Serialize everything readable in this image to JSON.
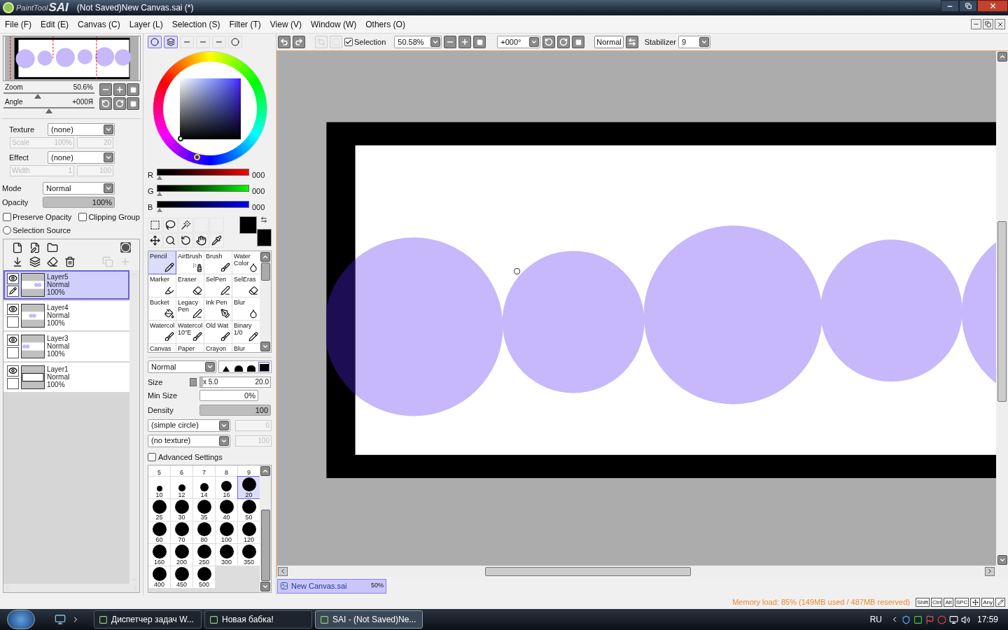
{
  "window": {
    "logo": [
      "PaintTool",
      "SAI"
    ],
    "title": "(Not Saved)New Canvas.sai (*)"
  },
  "menu": [
    "File (F)",
    "Edit (E)",
    "Canvas (C)",
    "Layer (L)",
    "Selection (S)",
    "Filter (T)",
    "View (V)",
    "Window (W)",
    "Others (O)"
  ],
  "navigator": {
    "sliders": [
      {
        "label": "Zoom",
        "value": "50.6%",
        "level": 0.38
      },
      {
        "label": "Angle",
        "value": "+000Я",
        "level": 0.5
      }
    ]
  },
  "texture": {
    "label": "Texture",
    "value": "(none)",
    "sub_label": "Scale",
    "sub_value": "100%",
    "amount": "20",
    "disabled": true
  },
  "effect": {
    "label": "Effect",
    "value": "(none)",
    "sub_label": "Width",
    "sub_value": "1",
    "amount": "100",
    "disabled": true
  },
  "mode": {
    "label": "Mode",
    "value": "Normal"
  },
  "opacity": {
    "label": "Opacity",
    "value": "100%",
    "level": 1
  },
  "options": [
    {
      "kind": "checkbox",
      "label": "Preserve Opacity",
      "checked": false
    },
    {
      "kind": "checkbox",
      "label": "Clipping Group",
      "checked": false
    },
    {
      "kind": "radio",
      "label": "Selection Source",
      "checked": false
    }
  ],
  "layers": [
    {
      "name": "Layer5",
      "mode": "Normal",
      "opacity": "100%",
      "selected": true,
      "visible": true
    },
    {
      "name": "Layer4",
      "mode": "Normal",
      "opacity": "100%",
      "selected": false,
      "visible": true
    },
    {
      "name": "Layer3",
      "mode": "Normal",
      "opacity": "100%",
      "selected": false,
      "visible": true
    },
    {
      "name": "Layer1",
      "mode": "Normal",
      "opacity": "100%",
      "selected": false,
      "visible": true
    }
  ],
  "color_tabs": [
    {
      "selected": true
    },
    {
      "selected": true
    },
    {
      "selected": false
    },
    {
      "selected": false
    },
    {
      "selected": false
    },
    {
      "selected": false
    }
  ],
  "rgb": [
    {
      "label": "R",
      "value": "000",
      "level": 0,
      "kind": "red"
    },
    {
      "label": "G",
      "value": "000",
      "level": 0,
      "kind": "green"
    },
    {
      "label": "B",
      "value": "000",
      "level": 0,
      "kind": "blue"
    }
  ],
  "swatches": [
    {
      "color": "#000000"
    },
    {
      "color": "#000000"
    }
  ],
  "tools": [
    {
      "lines": [
        "Pencil"
      ],
      "selected": true
    },
    {
      "lines": [
        "AirBrush"
      ],
      "selected": false
    },
    {
      "lines": [
        "Brush"
      ],
      "selected": false
    },
    {
      "lines": [
        "Water",
        "Color"
      ],
      "selected": false
    },
    {
      "lines": [
        "Marker"
      ],
      "selected": false
    },
    {
      "lines": [
        "Eraser"
      ],
      "selected": false
    },
    {
      "lines": [
        "SelPen"
      ],
      "selected": false
    },
    {
      "lines": [
        "SelEras"
      ],
      "selected": false
    },
    {
      "lines": [
        "Bucket"
      ],
      "selected": false
    },
    {
      "lines": [
        "Legacy",
        "Pen"
      ],
      "selected": false
    },
    {
      "lines": [
        "Ink Pen"
      ],
      "selected": false
    },
    {
      "lines": [
        "Blur"
      ],
      "selected": false
    },
    {
      "lines": [
        "Watercol"
      ],
      "selected": false
    },
    {
      "lines": [
        "Watercol",
        "10\"E"
      ],
      "selected": false
    },
    {
      "lines": [
        "Old Wat"
      ],
      "selected": false
    },
    {
      "lines": [
        "Binary",
        "1/0"
      ],
      "selected": false
    },
    {
      "lines": [
        "Canvas"
      ],
      "selected": false
    },
    {
      "lines": [
        "Paper"
      ],
      "selected": false
    },
    {
      "lines": [
        "Crayon"
      ],
      "selected": false
    },
    {
      "lines": [
        "Blur"
      ],
      "selected": false
    }
  ],
  "brush": {
    "mode": "Normal",
    "edges": [
      {
        "selected": false
      },
      {
        "selected": false
      },
      {
        "selected": false
      },
      {
        "selected": true
      }
    ],
    "size": {
      "label": "Size",
      "multiplier": "x 5.0",
      "value": "20.0",
      "level": 0.04
    },
    "min_size": {
      "label": "Min Size",
      "value": "0%"
    },
    "density": {
      "label": "Density",
      "value": "100",
      "level": 1
    },
    "shape": {
      "value": "(simple circle)",
      "amount": "0"
    },
    "paper": {
      "value": "(no texture)",
      "amount": "100"
    },
    "advanced": {
      "label": "Advanced Settings",
      "checked": false
    }
  },
  "sizes": [
    {
      "kind": "label",
      "label": "5",
      "selected": false
    },
    {
      "kind": "label",
      "label": "6",
      "selected": false
    },
    {
      "kind": "label",
      "label": "7",
      "selected": false
    },
    {
      "kind": "label",
      "label": "8",
      "selected": false
    },
    {
      "kind": "label",
      "label": "9",
      "selected": false
    },
    {
      "kind": "dot",
      "label": "10",
      "selected": false
    },
    {
      "kind": "dot",
      "label": "12",
      "selected": false
    },
    {
      "kind": "dot",
      "label": "14",
      "selected": false
    },
    {
      "kind": "dot",
      "label": "16",
      "selected": false
    },
    {
      "kind": "dot",
      "label": "20",
      "selected": true
    },
    {
      "kind": "dot",
      "label": "25",
      "selected": false
    },
    {
      "kind": "dot",
      "label": "30",
      "selected": false
    },
    {
      "kind": "dot",
      "label": "35",
      "selected": false
    },
    {
      "kind": "dot",
      "label": "40",
      "selected": false
    },
    {
      "kind": "dot",
      "label": "50",
      "selected": false
    },
    {
      "kind": "dot",
      "label": "60",
      "selected": false
    },
    {
      "kind": "dot",
      "label": "70",
      "selected": false
    },
    {
      "kind": "dot",
      "label": "80",
      "selected": false
    },
    {
      "kind": "dot",
      "label": "100",
      "selected": false
    },
    {
      "kind": "dot",
      "label": "120",
      "selected": false
    },
    {
      "kind": "dot",
      "label": "160",
      "selected": false
    },
    {
      "kind": "dot",
      "label": "200",
      "selected": false
    },
    {
      "kind": "dot",
      "label": "250",
      "selected": false
    },
    {
      "kind": "dot",
      "label": "300",
      "selected": false
    },
    {
      "kind": "dot",
      "label": "350",
      "selected": false
    },
    {
      "kind": "dot",
      "label": "400",
      "selected": false
    },
    {
      "kind": "dot",
      "label": "450",
      "selected": false
    },
    {
      "kind": "dot",
      "label": "500",
      "selected": false
    }
  ],
  "toolbar": {
    "selection": {
      "label": "Selection",
      "checked": true
    },
    "zoom": "50.58%",
    "angle": "+000°",
    "blend": "Normal",
    "stabilizer_label": "Stabilizer",
    "stabilizer": "9"
  },
  "canvas_tab": {
    "name": "New Canvas.sai",
    "zoom": "50%",
    "selected": true
  },
  "status": {
    "memory": "Memory load: 85% (149MB used / 487MB reserved)",
    "keys": [
      "Shift",
      "Ctrl",
      "Alt",
      "SPC",
      "Any"
    ]
  },
  "taskbar": {
    "tasks": [
      {
        "label": "Диспетчер задач W...",
        "selected": false
      },
      {
        "label": "Новая бабка!",
        "selected": false
      },
      {
        "label": "SAI - (Not Saved)Ne...",
        "selected": true
      }
    ],
    "language": "RU",
    "time": "17:59"
  }
}
